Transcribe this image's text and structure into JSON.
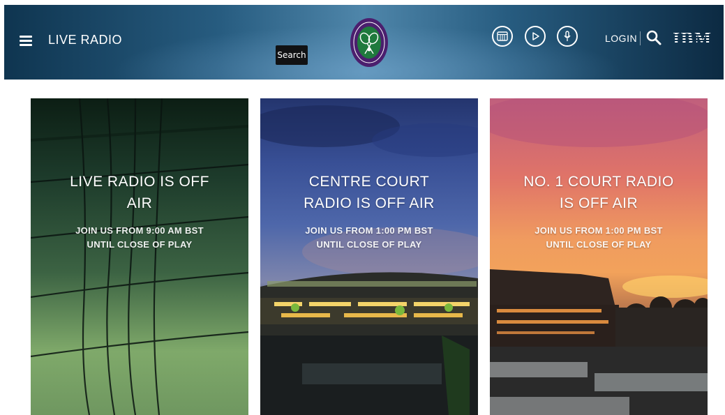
{
  "header": {
    "title": "LIVE RADIO",
    "tooltip": "Search",
    "login": "LOGIN",
    "sponsor": "IBM",
    "icons": [
      "hamburger-menu-icon",
      "schedule-icon",
      "play-icon",
      "microphone-icon",
      "search-icon"
    ],
    "logo_icon": "wimbledon-logo"
  },
  "cards": [
    {
      "title": "LIVE RADIO IS OFF AIR",
      "subtitle_line1": "JOIN US FROM 9:00 AM BST",
      "subtitle_line2": "UNTIL CLOSE OF PLAY"
    },
    {
      "title": "CENTRE COURT RADIO IS OFF AIR",
      "subtitle_line1": "JOIN US FROM 1:00 PM BST",
      "subtitle_line2": "UNTIL CLOSE OF PLAY"
    },
    {
      "title": "NO. 1 COURT RADIO IS OFF AIR",
      "subtitle_line1": "JOIN US FROM 1:00 PM BST",
      "subtitle_line2": "UNTIL CLOSE OF PLAY"
    }
  ],
  "colors": {
    "header_dark": "#0f3550",
    "header_light": "#4f86aa",
    "logo_purple": "#4b1f6e",
    "logo_green": "#1f7a3d",
    "text": "#ffffff"
  }
}
